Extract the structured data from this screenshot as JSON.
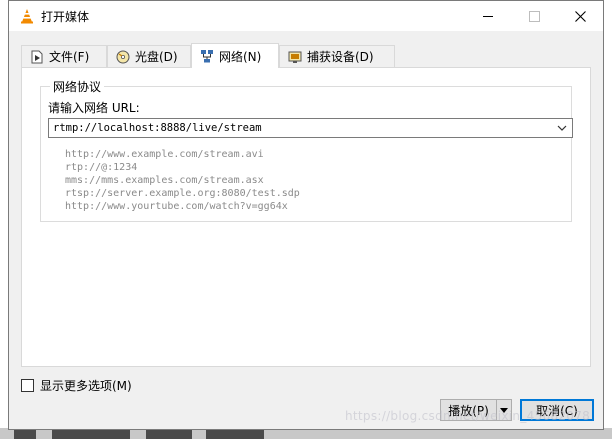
{
  "dialog": {
    "title": "打开媒体",
    "tabs": [
      {
        "label": "文件(F)",
        "icon": "file-play-icon"
      },
      {
        "label": "光盘(D)",
        "icon": "disc-icon"
      },
      {
        "label": "网络(N)",
        "icon": "network-icon"
      },
      {
        "label": "捕获设备(D)",
        "icon": "capture-device-icon"
      }
    ],
    "active_tab": "网络(N)",
    "network": {
      "group_title": "网络协议",
      "url_label": "请输入网络 URL:",
      "url_value": "rtmp://localhost:8888/live/stream",
      "examples": [
        "http://www.example.com/stream.avi",
        "rtp://@:1234",
        "mms://mms.examples.com/stream.asx",
        "rtsp://server.example.org:8080/test.sdp",
        "http://www.yourtube.com/watch?v=gg64x"
      ]
    },
    "more_options_label": "显示更多选项(M)",
    "play_label": "播放(P)",
    "cancel_label": "取消(C)"
  },
  "watermark": "https://blog.csdn.net/weixin_45682078",
  "colors": {
    "accent": "#0078d7",
    "dialog_bg": "#f0f0f0",
    "vlc_orange": "#f28a00"
  }
}
